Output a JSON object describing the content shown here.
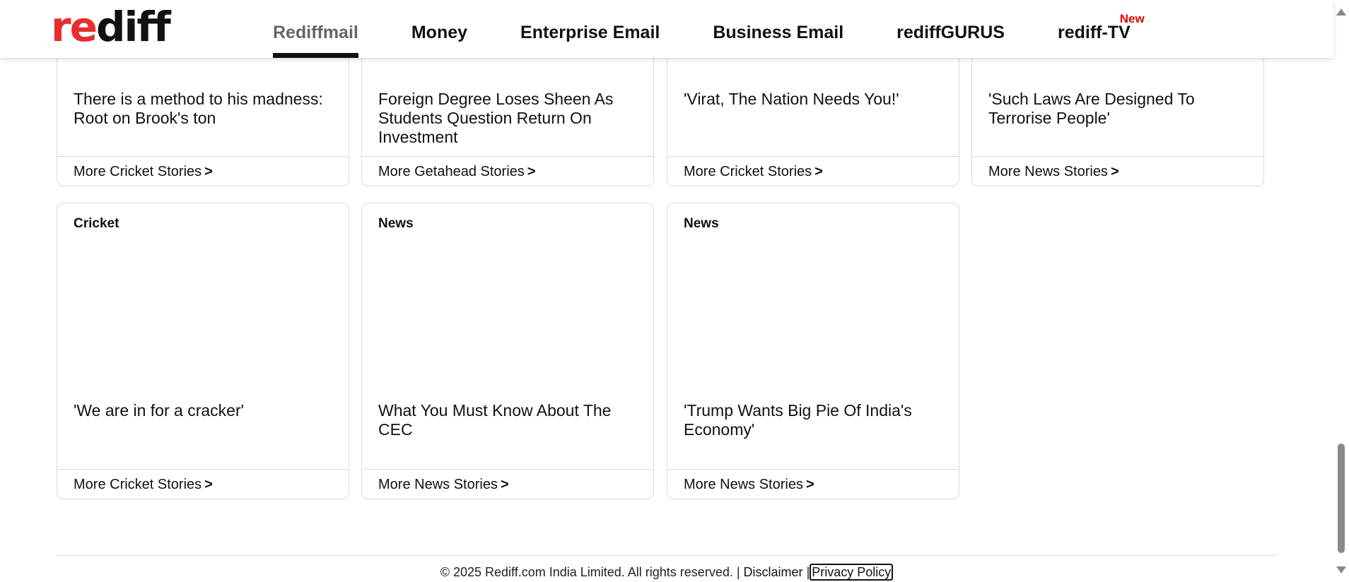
{
  "header": {
    "logo": {
      "re": "re",
      "diff": "diff"
    },
    "nav": [
      {
        "label": "Rediffmail",
        "active": true
      },
      {
        "label": "Money"
      },
      {
        "label": "Enterprise Email"
      },
      {
        "label": "Business Email"
      },
      {
        "label": "rediffGURUS"
      },
      {
        "label": "rediff-TV",
        "badge": "New"
      }
    ]
  },
  "cards_row1": [
    {
      "title": "There is a method to his madness: Root on Brook's ton",
      "more": "More Cricket Stories",
      "arrow": ">"
    },
    {
      "title": "Foreign Degree Loses Sheen As Students Question Return On Investment",
      "more": "More Getahead Stories",
      "arrow": ">"
    },
    {
      "title": "'Virat, The Nation Needs You!'",
      "more": "More Cricket Stories",
      "arrow": ">"
    },
    {
      "title": "'Such Laws Are Designed To Terrorise People'",
      "more": "More News Stories",
      "arrow": ">"
    }
  ],
  "cards_row2": [
    {
      "category": "Cricket",
      "title": "'We are in for a cracker'",
      "more": "More Cricket Stories",
      "arrow": ">"
    },
    {
      "category": "News",
      "title": "What You Must Know About The CEC",
      "more": "More News Stories",
      "arrow": ">"
    },
    {
      "category": "News",
      "title": "'Trump Wants Big Pie Of India's Economy'",
      "more": "More News Stories",
      "arrow": ">"
    }
  ],
  "footer": {
    "copyright": "© 2025 Rediff.com India Limited. All rights reserved. |",
    "disclaimer": "Disclaimer",
    "separator": "|",
    "privacy": "Privacy Policy"
  },
  "colors": {
    "brand_red": "#e62e2d",
    "badge_red": "#e60000"
  }
}
